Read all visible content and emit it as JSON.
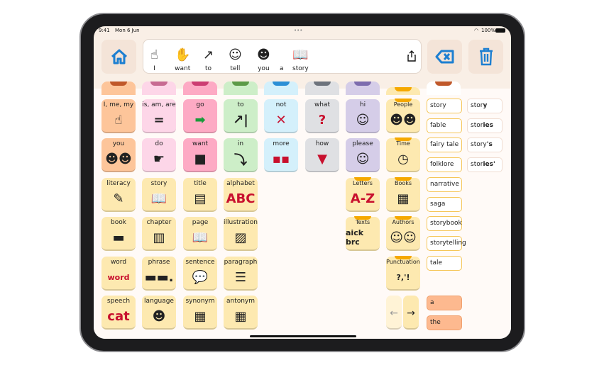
{
  "status": {
    "time": "9:41",
    "date": "Mon 6 Jun",
    "battery": "100%"
  },
  "header": {
    "home_icon": "home-icon",
    "share_icon": "share-icon",
    "backspace_icon": "backspace-icon",
    "trash_icon": "trash-icon",
    "sentence": [
      {
        "word": "I",
        "pic": "☝"
      },
      {
        "word": "want",
        "pic": "✋"
      },
      {
        "word": "to",
        "pic": "↗"
      },
      {
        "word": "tell",
        "pic": "☺"
      },
      {
        "word": "you",
        "pic": "☻"
      },
      {
        "word": "a",
        "pic": ""
      },
      {
        "word": "story",
        "pic": "📖"
      }
    ]
  },
  "tabs": [
    "#c0582a",
    "#c76b92",
    "#cc3d72",
    "#5c9a48",
    "#2b8fd6",
    "#6d737c",
    "#7d6cae",
    "#f5a800",
    "#c0582a"
  ],
  "grid": [
    [
      {
        "label": "I, me, my",
        "g": "☝",
        "c": "orange"
      },
      {
        "label": "is, am, are",
        "g": "=",
        "c": "lpink"
      },
      {
        "label": "go",
        "g": "➡",
        "c": "pink"
      },
      {
        "label": "to",
        "g": "↗|",
        "c": "green"
      },
      {
        "label": "not",
        "g": "✕",
        "c": "blue"
      },
      {
        "label": "what",
        "g": "?",
        "c": "gray"
      },
      {
        "label": "hi",
        "g": "☺",
        "c": "purple"
      },
      {
        "label": "People",
        "g": "☻☻",
        "c": "yellow",
        "cat": true
      }
    ],
    [
      {
        "label": "you",
        "g": "☻☻",
        "c": "orange"
      },
      {
        "label": "do",
        "g": "☛",
        "c": "lpink"
      },
      {
        "label": "want",
        "g": "■",
        "c": "pink"
      },
      {
        "label": "in",
        "g": "⤵",
        "c": "green"
      },
      {
        "label": "more",
        "g": "▪▪",
        "c": "blue"
      },
      {
        "label": "how",
        "g": "▼",
        "c": "gray"
      },
      {
        "label": "please",
        "g": "☺",
        "c": "purple"
      },
      {
        "label": "Time",
        "g": "◷",
        "c": "yellow",
        "cat": true
      }
    ],
    [
      {
        "label": "literacy",
        "g": "✎",
        "c": "yellow"
      },
      {
        "label": "story",
        "g": "📖",
        "c": "yellow"
      },
      {
        "label": "title",
        "g": "▤",
        "c": "yellow"
      },
      {
        "label": "alphabet",
        "g": "ABC",
        "c": "yellow"
      },
      null,
      null,
      {
        "label": "Letters",
        "g": "A-Z",
        "c": "yellow",
        "cat": true
      },
      {
        "label": "Books",
        "g": "▦",
        "c": "yellow",
        "cat": true
      }
    ],
    [
      {
        "label": "book",
        "g": "▬",
        "c": "yellow"
      },
      {
        "label": "chapter",
        "g": "▥",
        "c": "yellow"
      },
      {
        "label": "page",
        "g": "📖",
        "c": "yellow"
      },
      {
        "label": "illustration",
        "g": "▨",
        "c": "yellow"
      },
      null,
      null,
      {
        "label": "Texts",
        "g": "aick brc",
        "c": "yellow",
        "cat": true
      },
      {
        "label": "Authors",
        "g": "☺☺",
        "c": "yellow",
        "cat": true
      }
    ],
    [
      {
        "label": "word",
        "g": "word",
        "c": "yellow"
      },
      {
        "label": "phrase",
        "g": "▬▬.",
        "c": "yellow"
      },
      {
        "label": "sentence",
        "g": "💬",
        "c": "yellow"
      },
      {
        "label": "paragraph",
        "g": "☰",
        "c": "yellow"
      },
      null,
      null,
      null,
      {
        "label": "Punctuation",
        "g": "?,'!",
        "c": "yellow",
        "cat": true
      }
    ],
    [
      {
        "label": "speech",
        "g": "cat",
        "c": "yellow"
      },
      {
        "label": "language",
        "g": "☻",
        "c": "yellow"
      },
      {
        "label": "synonym",
        "g": "▦",
        "c": "yellow"
      },
      {
        "label": "antonym",
        "g": "▦",
        "c": "yellow"
      },
      null,
      null,
      null,
      null
    ]
  ],
  "colors": {
    "orange": "#fdc59a",
    "lpink": "#fdd6e8",
    "pink": "#fdaac4",
    "green": "#cdeec8",
    "blue": "#d4f0fb",
    "gray": "#dfe0e3",
    "purple": "#d5cde8",
    "yellow": "#fde9b0"
  },
  "word_list": [
    "story",
    "fable",
    "fairy tale",
    "folklore",
    "narrative",
    "saga",
    "storybook",
    "storytelling",
    "tale"
  ],
  "word_forms": [
    {
      "stem": "stor",
      "end": "y"
    },
    {
      "stem": "stor",
      "end": "ies"
    },
    {
      "stem": "story",
      "end": "'s"
    },
    {
      "stem": "stor",
      "end": "ies'"
    }
  ],
  "articles": [
    "a",
    "the"
  ],
  "nav": {
    "prev": "←",
    "next": "→"
  },
  "tools": [
    "keyboard-icon",
    "search-icon",
    "pencil-icon"
  ]
}
